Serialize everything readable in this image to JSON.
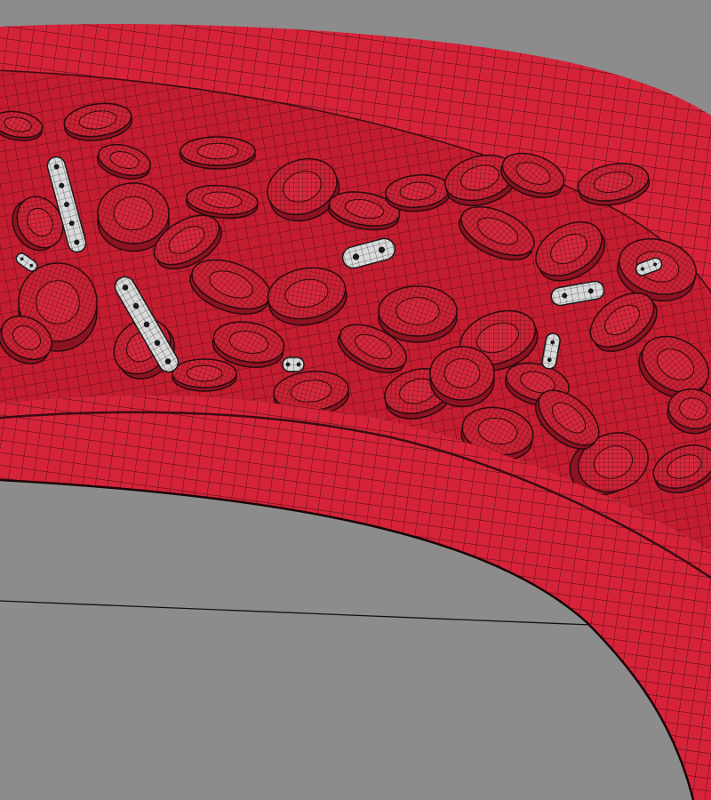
{
  "scene": {
    "subject": "blood-vessel-wireframe-render",
    "colors": {
      "background": "#8c8c8c",
      "vessel_wall": "#d6233a",
      "vessel_wall_shadow": "#a31527",
      "vessel_interior": "#c41c30",
      "interior_back": "#b51a2c",
      "cell": "#cc2236",
      "cell_dark": "#8e1322",
      "cell_top": "#d8283d",
      "mesh_line": "#2a0a0e",
      "nanobot": "#d9d9d9",
      "nanobot_dark": "#1a1a1a"
    },
    "render_style": "wireframe-mesh",
    "red_blood_cells": {
      "shape": "biconcave-disc"
    },
    "nanobots": {
      "shape": "capsule-with-gear-rings"
    }
  }
}
